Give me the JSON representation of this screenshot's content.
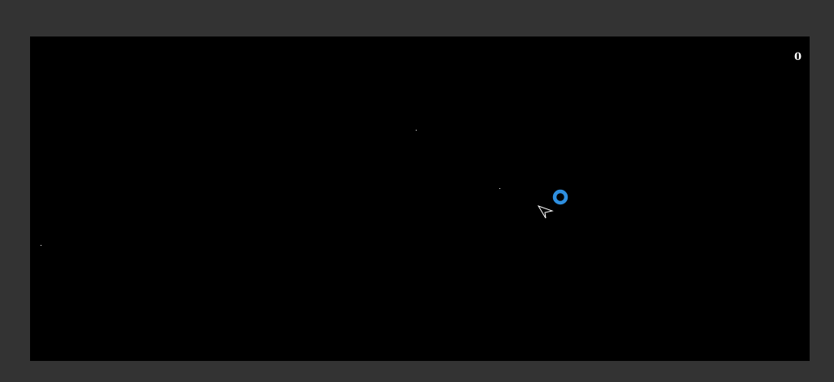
{
  "game": {
    "score": "0",
    "colors": {
      "frame": "#333333",
      "background": "#000000",
      "ring": "#2e8fe0",
      "ship": "#ffffff",
      "star": "#ffffff"
    },
    "icons": {
      "ship": "arrow-ship-icon",
      "target": "blue-ring-icon"
    }
  }
}
